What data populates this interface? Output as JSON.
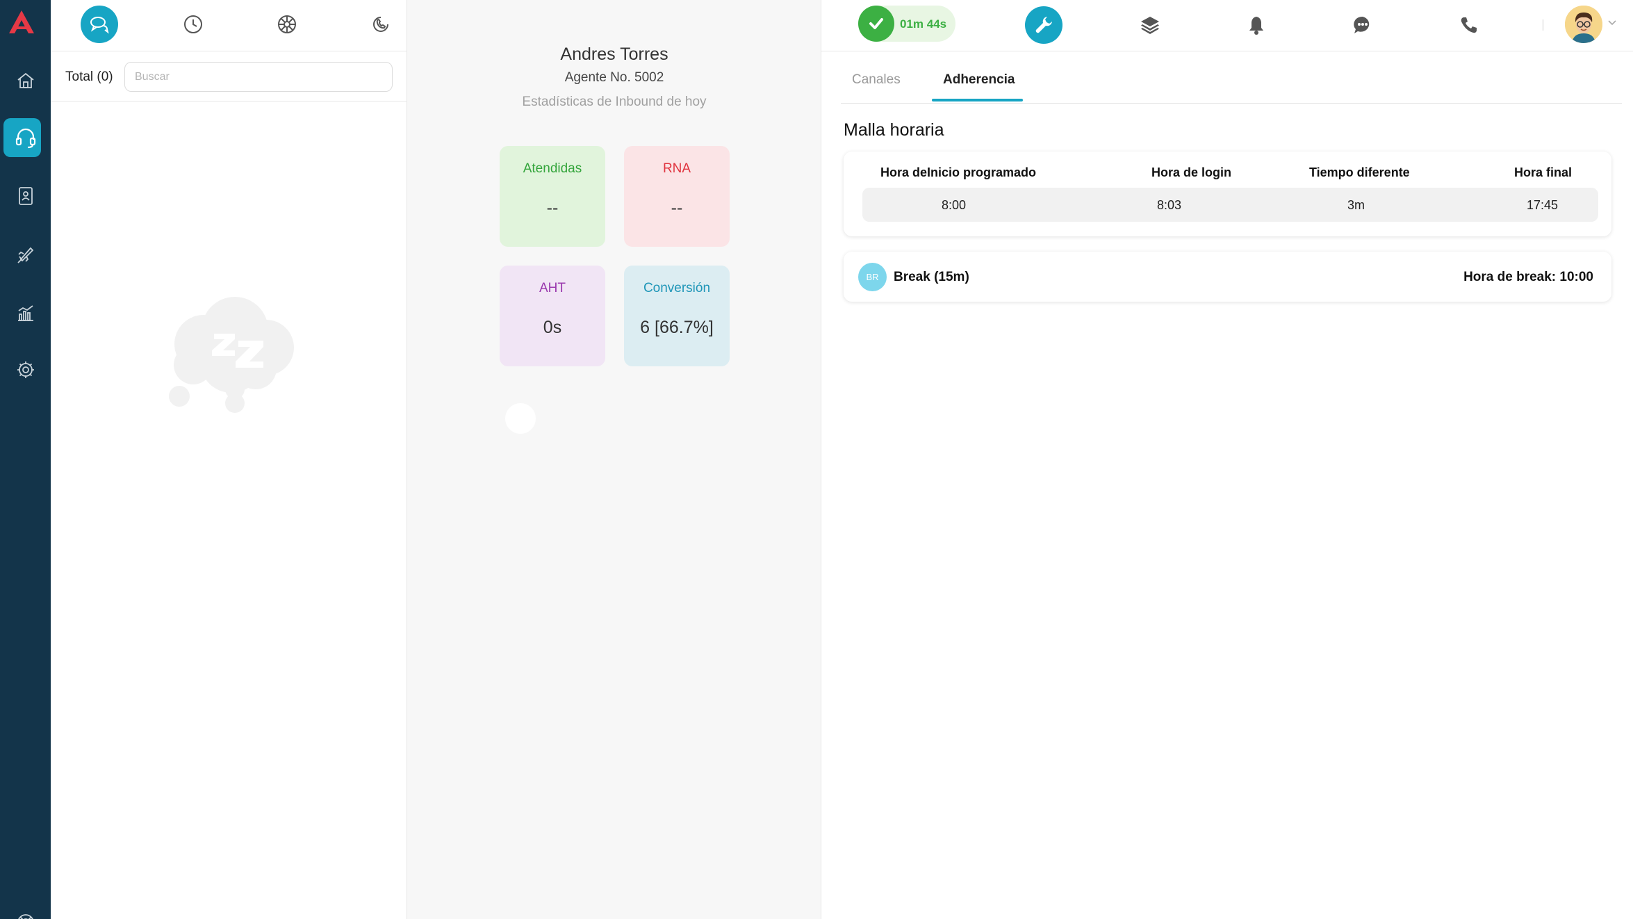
{
  "colors": {
    "rail": "#13344a",
    "accent": "#17a5c4",
    "success": "#3cb043",
    "logo": "#e63946"
  },
  "rail": {
    "items": [
      {
        "icon": "home-icon"
      },
      {
        "icon": "headset-icon",
        "active": true
      },
      {
        "icon": "contacts-book-icon"
      },
      {
        "icon": "campaign-rocket-icon"
      },
      {
        "icon": "reports-chart-icon"
      },
      {
        "icon": "settings-gear-icon"
      },
      {
        "icon": "help-lifebuoy-icon"
      }
    ]
  },
  "left_panel": {
    "tabs": [
      {
        "icon": "chat-bubbles-icon",
        "active": true
      },
      {
        "icon": "clock-history-icon"
      },
      {
        "icon": "omnichannel-wheel-icon"
      },
      {
        "icon": "phone-history-icon"
      }
    ],
    "total_label": "Total (0)",
    "search_placeholder": "Buscar",
    "empty_state_icon": "sleep-cloud-icon"
  },
  "agent_panel": {
    "name": "Andres Torres",
    "agent_number": "Agente No. 5002",
    "subtitle": "Estadísticas de Inbound de hoy",
    "cards": {
      "atendidas": {
        "label": "Atendidas",
        "value": "--"
      },
      "rna": {
        "label": "RNA",
        "value": "--"
      },
      "aht": {
        "label": "AHT",
        "value": "0s"
      },
      "conversion": {
        "label": "Conversión",
        "value": "6 [66.7%]"
      }
    }
  },
  "topbar": {
    "status_timer": "01m 44s",
    "icons": [
      "wrench-icon",
      "layers-icon",
      "bell-icon",
      "chat-icon",
      "phone-icon"
    ]
  },
  "details": {
    "tabs": {
      "canales": "Canales",
      "adherencia": "Adherencia"
    },
    "section_title": "Malla horaria",
    "schedule": {
      "headers": {
        "inicio": "Hora deInicio programado",
        "login": "Hora de login",
        "diff": "Tiempo diferente",
        "final": "Hora final"
      },
      "values": {
        "inicio": "8:00",
        "login": "8:03",
        "diff": "3m",
        "final": "17:45"
      }
    },
    "break": {
      "badge": "BR",
      "label": "Break (15m)",
      "time": "Hora de break: 10:00"
    }
  }
}
